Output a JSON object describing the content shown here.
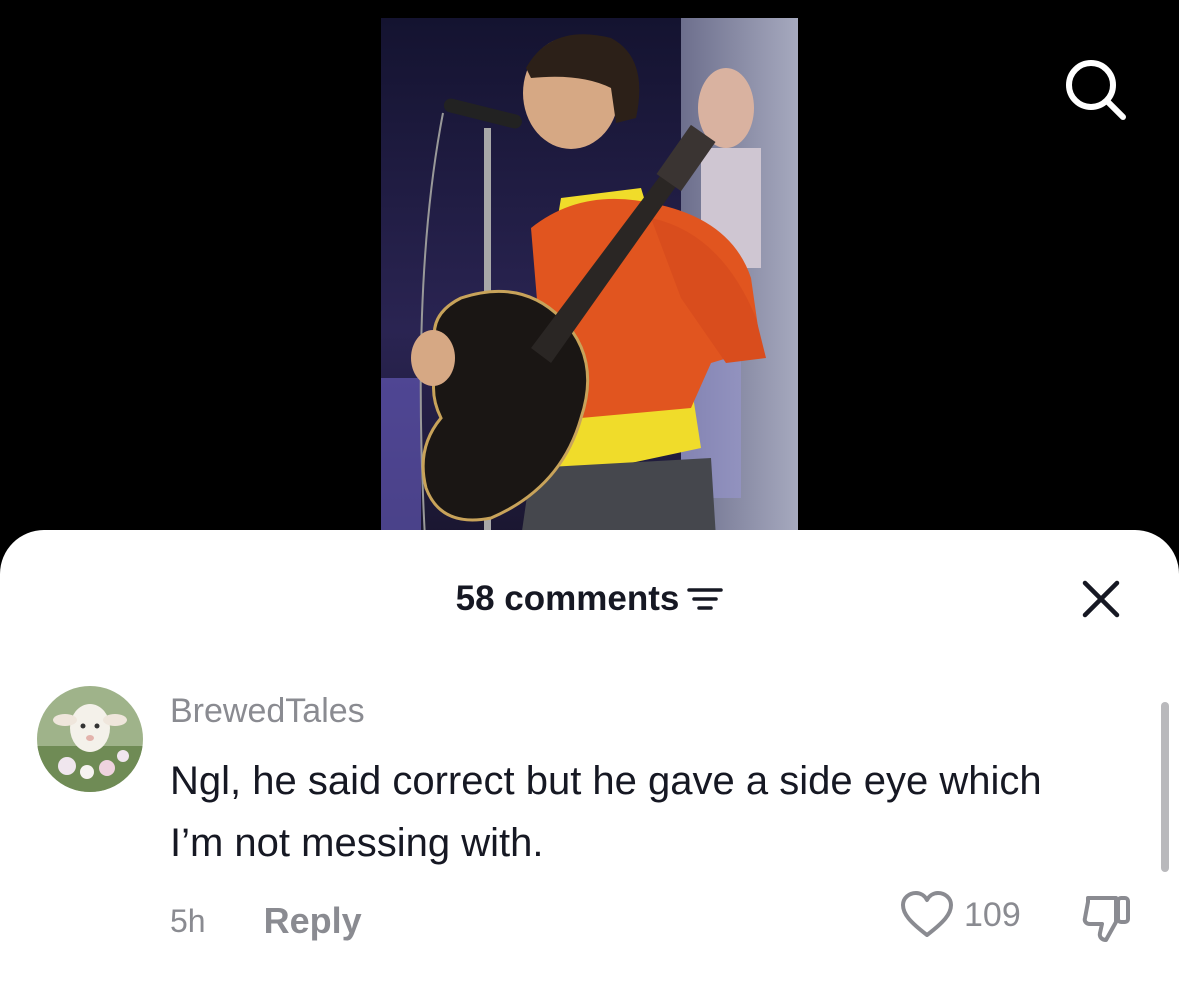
{
  "video": {
    "thumbnail_icon": "concert-performer-image",
    "search_icon": "search-icon"
  },
  "comments_sheet": {
    "count_label": "58 comments",
    "sort_icon": "sort-filter-icon",
    "close_icon": "close-icon"
  },
  "comment": {
    "username": "BrewedTales",
    "avatar_icon": "lamb-avatar",
    "text": "Ngl, he said correct but he gave a side eye which I’m not messing with.",
    "time": "5h",
    "reply_label": "Reply",
    "like_icon": "heart-outline-icon",
    "like_count": "109",
    "dislike_icon": "thumbs-down-icon"
  }
}
